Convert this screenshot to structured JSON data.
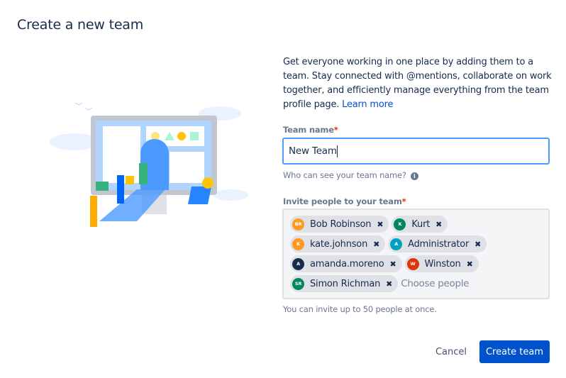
{
  "dialog": {
    "title": "Create a new team"
  },
  "description": {
    "text": "Get everyone working in one place by adding them to a team. Stay connected with @mentions, collaborate on work together, and efficiently manage everything from the team profile page.",
    "link": "Learn more"
  },
  "team_name": {
    "label": "Team name",
    "required": "*",
    "value": "New Team",
    "help": "Who can see your team name?",
    "help_icon": "info-icon"
  },
  "invite": {
    "label": "Invite people to your team",
    "required": "*",
    "placeholder": "Choose people",
    "help": "You can invite up to 50 people at once.",
    "people": [
      {
        "name": "Bob Robinson",
        "initials": "BR",
        "color": "#FF991F"
      },
      {
        "name": "Kurt",
        "initials": "K",
        "color": "#00875A"
      },
      {
        "name": "kate.johnson",
        "initials": "K",
        "color": "#FF991F"
      },
      {
        "name": "Administrator",
        "initials": "A",
        "color": "#00A3BF"
      },
      {
        "name": "amanda.moreno",
        "initials": "A",
        "color": "#172B4D"
      },
      {
        "name": "Winston",
        "initials": "W",
        "color": "#DE350B"
      },
      {
        "name": "Simon Richman",
        "initials": "SR",
        "color": "#00875A"
      }
    ]
  },
  "actions": {
    "cancel": "Cancel",
    "create": "Create team"
  },
  "colors": {
    "primary": "#0052CC",
    "focus": "#4C9AFF"
  }
}
